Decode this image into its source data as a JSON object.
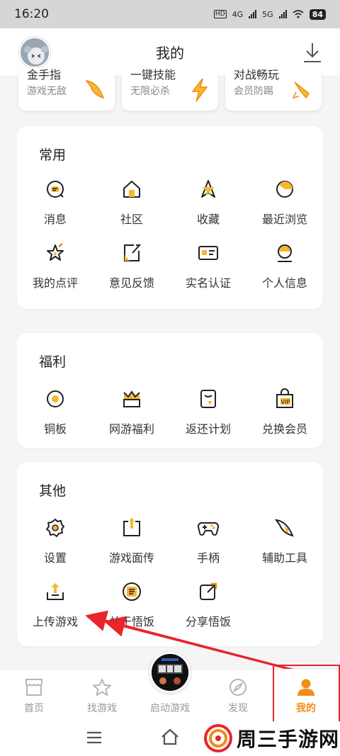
{
  "status_bar": {
    "time": "16:20",
    "network": "4G",
    "network2": "5G",
    "hd": "HD",
    "battery": "84"
  },
  "header": {
    "title": "我的"
  },
  "promo_cards": [
    {
      "title": "金手指",
      "subtitle": "游戏无敌"
    },
    {
      "title": "一键技能",
      "subtitle": "无限必杀"
    },
    {
      "title": "对战畅玩",
      "subtitle": "会员防踢"
    }
  ],
  "sections": {
    "common": {
      "title": "常用",
      "items": [
        "消息",
        "社区",
        "收藏",
        "最近浏览",
        "我的点评",
        "意见反馈",
        "实名认证",
        "个人信息"
      ]
    },
    "welfare": {
      "title": "福利",
      "items": [
        "铜板",
        "网游福利",
        "返还计划",
        "兑换会员"
      ]
    },
    "other": {
      "title": "其他",
      "items": [
        "设置",
        "游戏面传",
        "手柄",
        "辅助工具",
        "上传游戏",
        "关于悟饭",
        "分享悟饭"
      ]
    }
  },
  "tabs": [
    {
      "label": "首页"
    },
    {
      "label": "找游戏"
    },
    {
      "label": "启动游戏"
    },
    {
      "label": "发现"
    },
    {
      "label": "我的"
    }
  ],
  "watermark": {
    "text": "周三手游网"
  },
  "colors": {
    "accent": "#f08c19",
    "annotation_red": "#e8252b"
  }
}
